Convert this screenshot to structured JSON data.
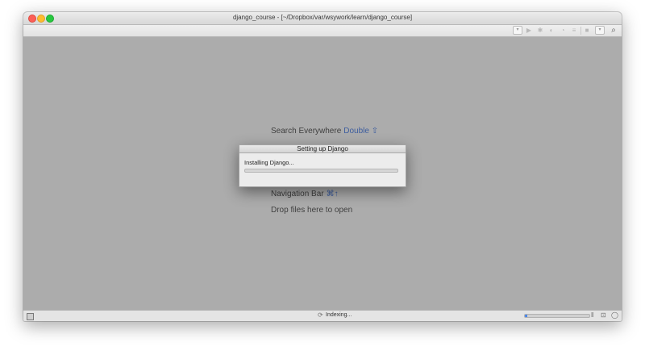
{
  "window": {
    "title": "django_course - [~/Dropbox/var/wsywork/learn/django_course]"
  },
  "toolbar": {
    "icons": [
      "dropdown-icon",
      "run-icon",
      "debug-icon",
      "coverage-icon",
      "profile-icon",
      "concurrency-icon",
      "stop-icon",
      "dropdown-icon",
      "search-icon"
    ],
    "glyphs": {
      "dropdown": "▾",
      "run": "▶",
      "debug": "✱",
      "coverage": "◐",
      "profile": "◔",
      "concurrency": "≡",
      "stop": "■",
      "search": "⌕"
    }
  },
  "hints": {
    "search_everywhere": {
      "label": "Search Everywhere",
      "key": "Double ⇧"
    },
    "navigation_bar": {
      "label": "Navigation Bar",
      "key": "⌘↑"
    },
    "drop_files": "Drop files here to open"
  },
  "dialog": {
    "title": "Setting up Django",
    "message": "Installing Django...",
    "progress": 0.0
  },
  "statusbar": {
    "spinner": "⟳",
    "text": "Indexing...",
    "progress_fraction": 0.04,
    "pause_glyph": "‖",
    "lock_glyph": "⊡",
    "notify_glyph": "◯"
  },
  "colors": {
    "background": "#acacac",
    "accent_key": "#3d5d9e",
    "progress_blue": "#4a86e8"
  }
}
